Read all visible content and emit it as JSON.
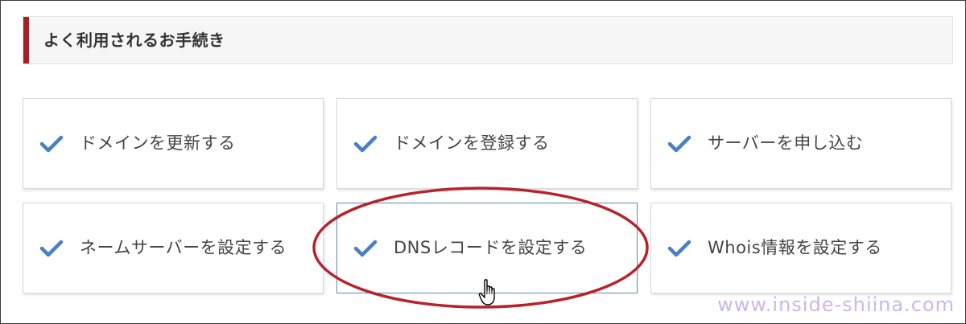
{
  "section": {
    "title": "よく利用されるお手続き"
  },
  "cards": [
    {
      "label": "ドメインを更新する",
      "icon": "check-icon"
    },
    {
      "label": "ドメインを登録する",
      "icon": "check-icon"
    },
    {
      "label": "サーバーを申し込む",
      "icon": "check-icon"
    },
    {
      "label": "ネームサーバーを設定する",
      "icon": "check-icon"
    },
    {
      "label": "DNSレコードを設定する",
      "icon": "check-icon",
      "state": "hover"
    },
    {
      "label": "Whois情報を設定する",
      "icon": "check-icon"
    }
  ],
  "watermark": "www.inside-shiina.com",
  "colors": {
    "accent_bar": "#a61f24",
    "check": "#4a7fc1",
    "annotation_ellipse": "#b8222b",
    "hover_border": "#5b87b5",
    "watermark": "#c9b8ea"
  }
}
